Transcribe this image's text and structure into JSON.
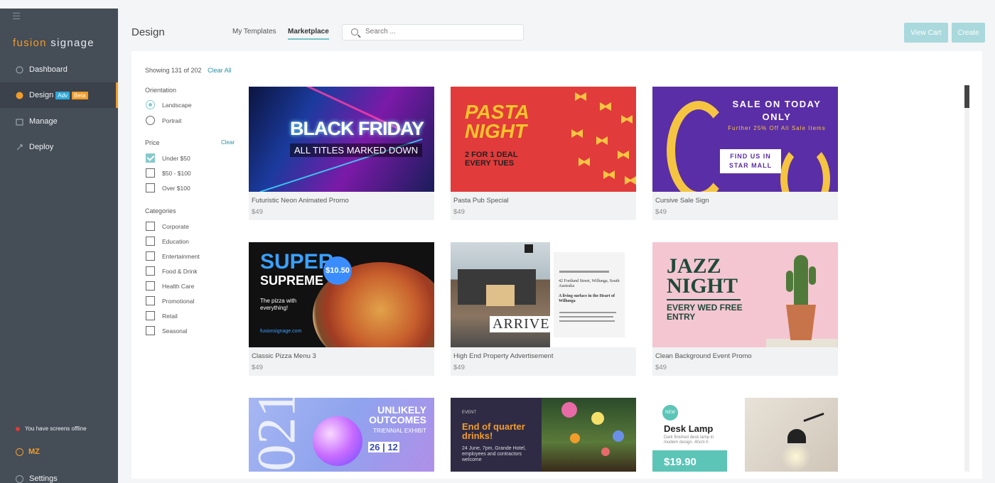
{
  "sidebar": {
    "brand_prefix": "fusion",
    "brand_suffix": "signage",
    "nav": [
      {
        "label": "Dashboard"
      },
      {
        "label": "Design",
        "badges": [
          "Adv",
          "Beta"
        ]
      },
      {
        "label": "Manage"
      },
      {
        "label": "Deploy"
      }
    ],
    "offline_text": "You have screens offline",
    "user_initials": "MZ",
    "settings_label": "Settings"
  },
  "header": {
    "title": "Design",
    "tabs": [
      "My Templates",
      "Marketplace"
    ],
    "active_tab": "Marketplace",
    "search_placeholder": "Search ...",
    "view_cart_label": "View Cart",
    "create_label": "Create"
  },
  "filters": {
    "showing": "Showing 131 of 202",
    "clear_all": "Clear All",
    "orientation": {
      "heading": "Orientation",
      "options": [
        {
          "label": "Landscape",
          "selected": true
        },
        {
          "label": "Portrait",
          "selected": false
        }
      ]
    },
    "price": {
      "heading": "Price",
      "clear": "Clear",
      "options": [
        {
          "label": "Under $50",
          "checked": true
        },
        {
          "label": "$50 - $100",
          "checked": false
        },
        {
          "label": "Over $100",
          "checked": false
        }
      ]
    },
    "categories": {
      "heading": "Categories",
      "options": [
        {
          "label": "Corporate",
          "checked": false
        },
        {
          "label": "Education",
          "checked": false
        },
        {
          "label": "Entertainment",
          "checked": false
        },
        {
          "label": "Food & Drink",
          "checked": false
        },
        {
          "label": "Health Care",
          "checked": false
        },
        {
          "label": "Promotional",
          "checked": false
        },
        {
          "label": "Retail",
          "checked": false
        },
        {
          "label": "Seasonal",
          "checked": false
        }
      ]
    }
  },
  "templates": [
    {
      "name": "Futuristic Neon Animated Promo",
      "price": "$49",
      "art": {
        "t1": "BLACK FRIDAY",
        "t2": "ALL TITLES MARKED DOWN"
      }
    },
    {
      "name": "Pasta Pub Special",
      "price": "$49",
      "art": {
        "t1": "PASTA NIGHT",
        "t2": "2 FOR 1 DEAL EVERY TUES"
      }
    },
    {
      "name": "Cursive Sale Sign",
      "price": "$49",
      "art": {
        "t1": "SALE ON TODAY ONLY",
        "t2": "Further 25% Off All Sale Items",
        "t3": "FIND US IN STAR MALL"
      }
    },
    {
      "name": "Classic Pizza Menu 3",
      "price": "$49",
      "art": {
        "t1": "SUPER",
        "t2": "SUPREME",
        "t3": "The pizza with everything!",
        "badge": "$10.50",
        "link": "fusionsignage.com"
      }
    },
    {
      "name": "High End Property Advertisement",
      "price": "$49",
      "art": {
        "t1": "ARRIVE",
        "t2": "42 Fortlund Street, Willunga, South Australia",
        "t3": "A living surface in the Heart of Willunga"
      }
    },
    {
      "name": "Clean Background Event Promo",
      "price": "$49",
      "art": {
        "t1": "JAZZ NIGHT",
        "t2": "EVERY WED FREE ENTRY"
      }
    },
    {
      "name": "",
      "price": "",
      "art": {
        "t0": "021",
        "t1": "UNLIKELY OUTCOMES",
        "t2": "TRIENNIAL EXHIBIT",
        "date": "26 | 12"
      }
    },
    {
      "name": "",
      "price": "",
      "art": {
        "t0": "EVENT",
        "t1": "End of quarter drinks!",
        "t2": "24 June, 7pm, Grande Hotel, employees and contractors welcome"
      }
    },
    {
      "name": "",
      "price": "",
      "art": {
        "badge": "NEW",
        "t1": "Desk Lamp",
        "t2": "Dark finished desk lamp in modern design. 40cm h",
        "price": "$19.90"
      }
    }
  ]
}
